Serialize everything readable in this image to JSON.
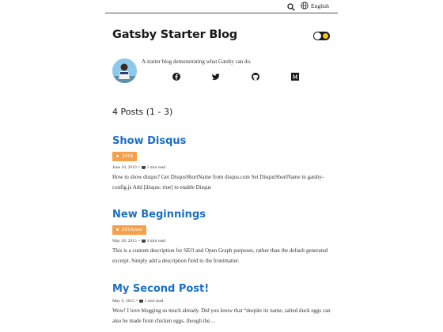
{
  "header": {
    "language_label": "English"
  },
  "site": {
    "title": "Gatsby Starter Blog",
    "bio": "A starter blog demonstrating what Gatsby can do."
  },
  "socials": [
    {
      "icon": "facebook-icon"
    },
    {
      "icon": "twitter-icon"
    },
    {
      "icon": "github-icon"
    },
    {
      "icon": "medium-icon"
    }
  ],
  "posts_count": "4 Posts (1 - 3)",
  "posts": [
    {
      "title": "Show Disqus",
      "tag": "2019",
      "date": "June 10, 2019",
      "read_time": "1 min read",
      "excerpt": "How to show disqus? Get DisqusShortName from disqus.com Set DisqusShortName in gatsby-config.js Add [disqus: true] to enable Disqus"
    },
    {
      "title": "New Beginnings",
      "tag": "2019year",
      "date": "May 28, 2015",
      "read_time": "4 min read",
      "excerpt": "This is a custom description for SEO and Open Graph purposes, rather than the default generated excerpt. Simply add a description field to the frontmatter."
    },
    {
      "title": "My Second Post!",
      "tag": "",
      "date": "May 6, 2015",
      "read_time": "1 min read",
      "excerpt": "Wow! I love blogging so much already. Did you know that “despite its name, salted duck eggs can also be made from chicken eggs, though the…"
    }
  ],
  "colors": {
    "link": "#1c6fc4",
    "tag": "#f5a04a",
    "toggle": "#1c1c1c",
    "sun": "#f5c518"
  }
}
